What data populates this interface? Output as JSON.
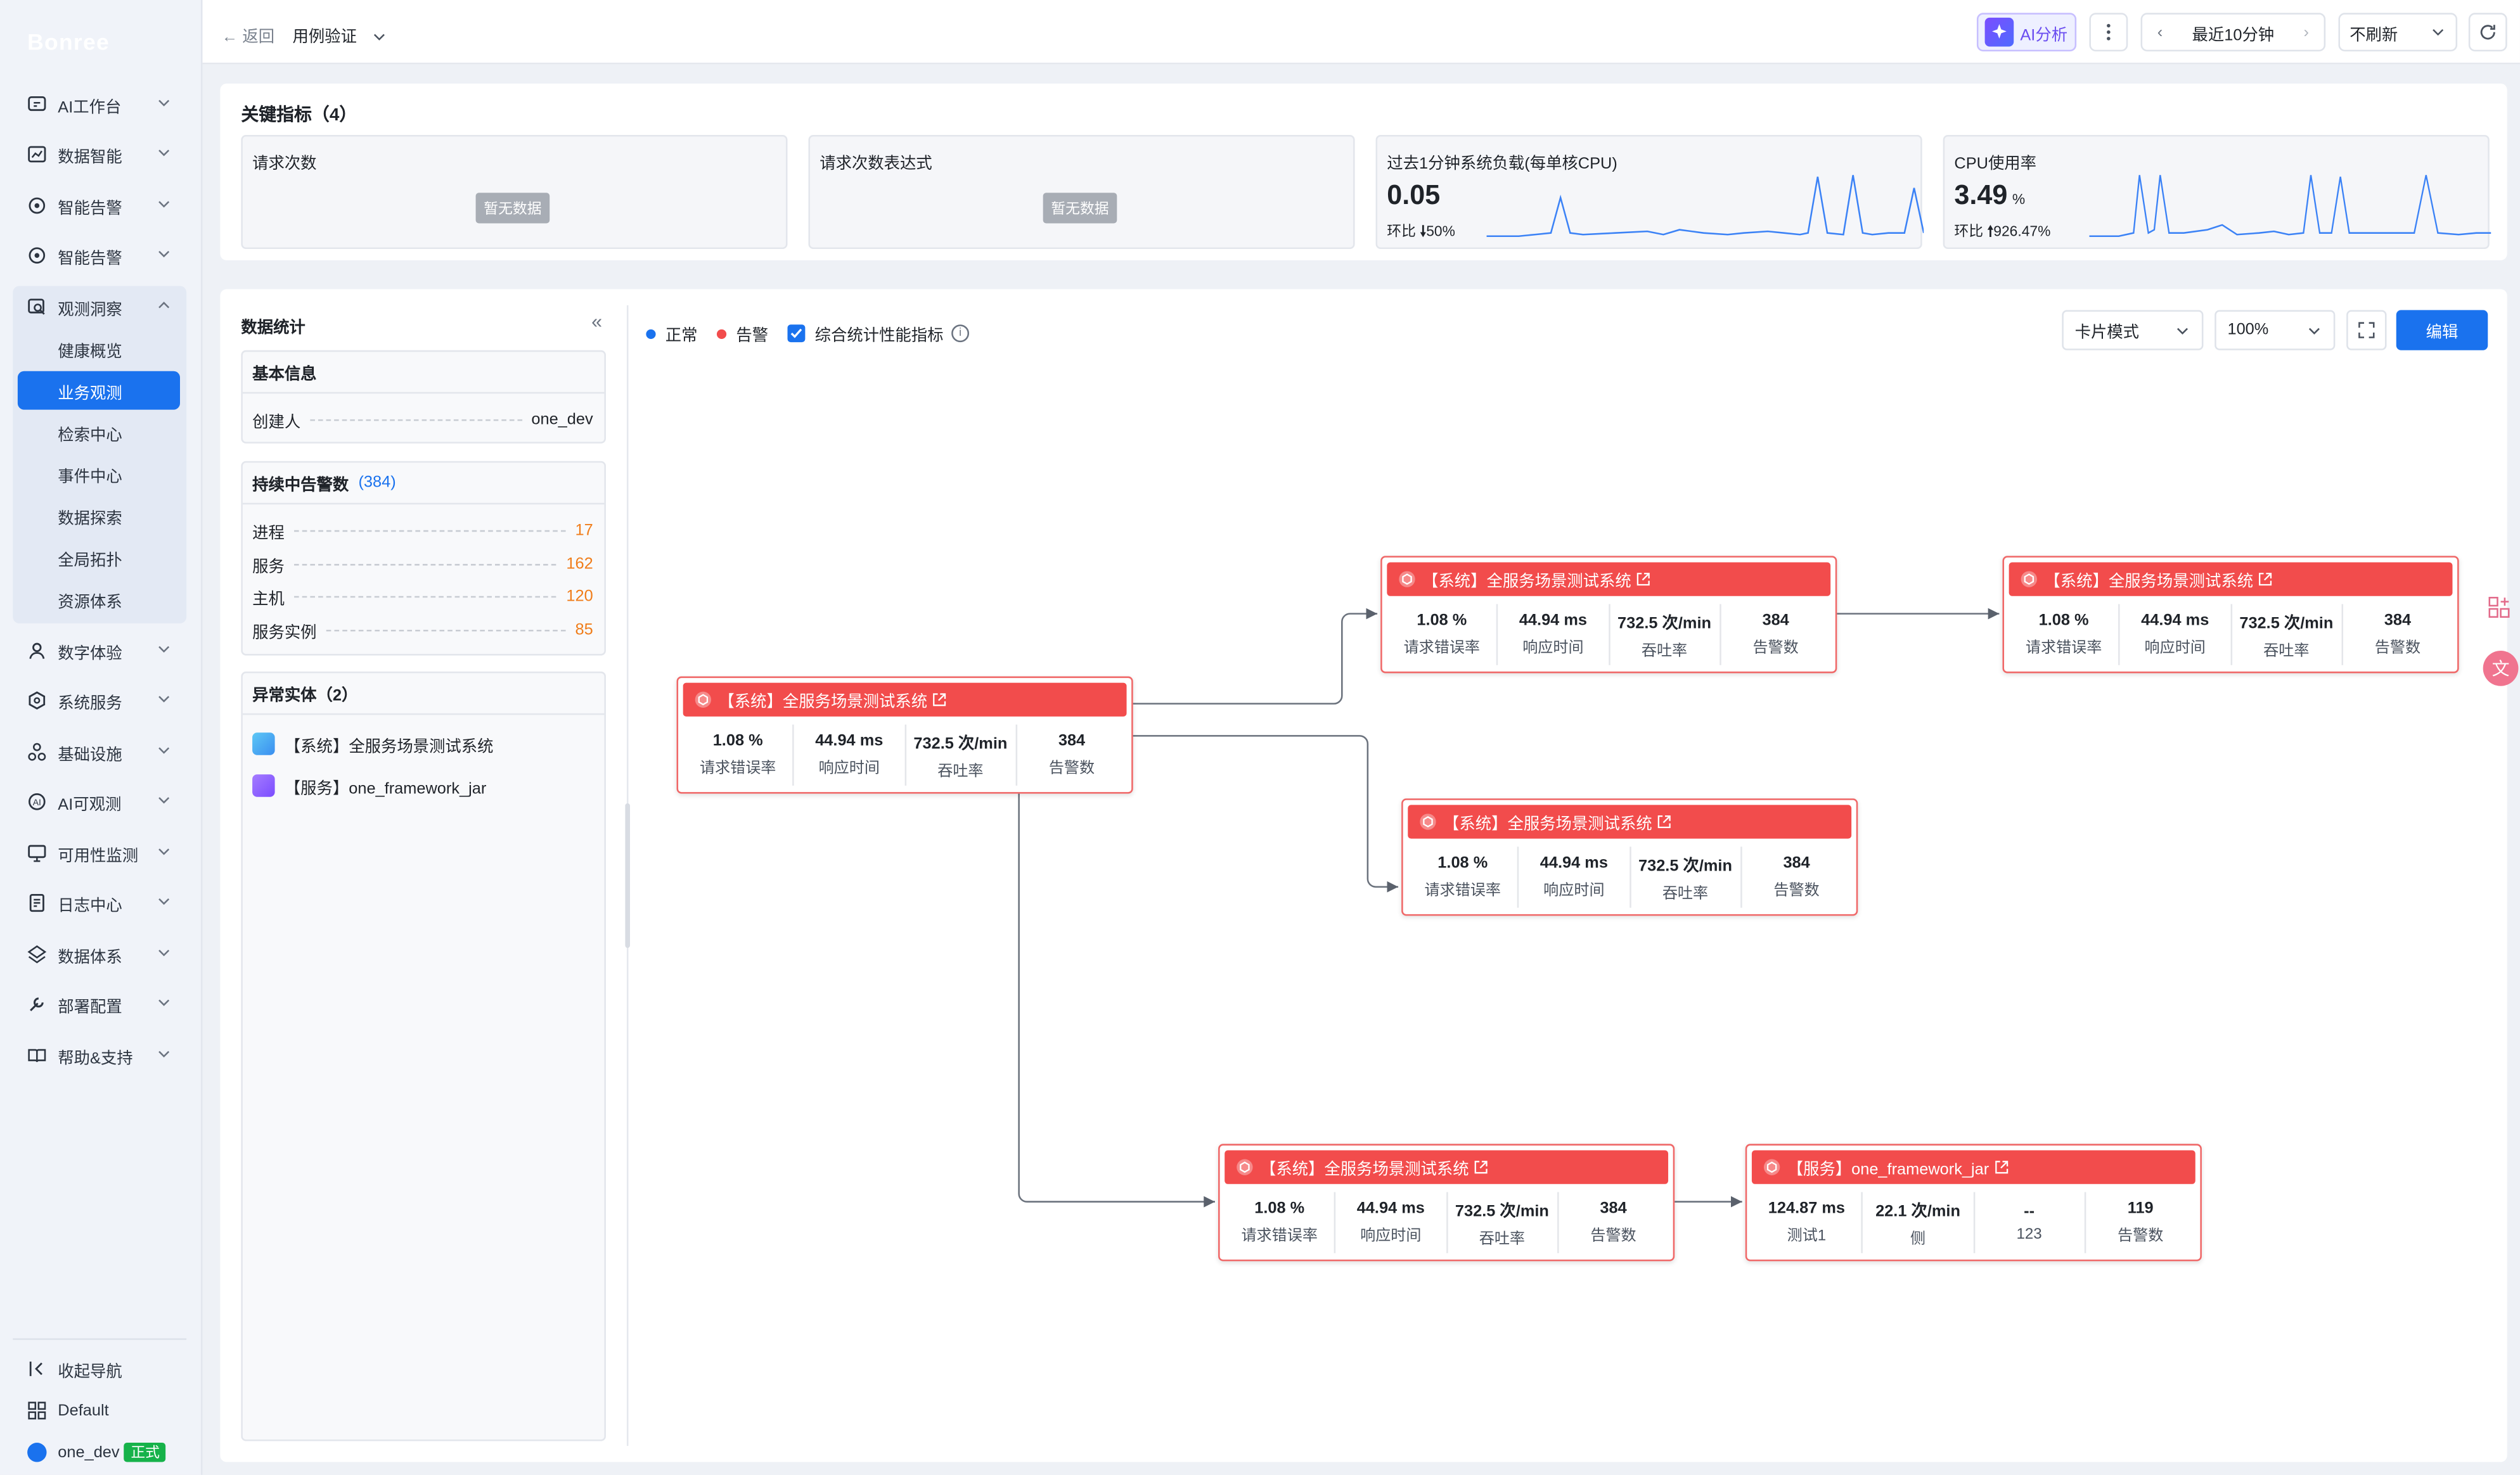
{
  "sidebar": {
    "logo": "Bonree",
    "items": [
      {
        "label": "AI工作台",
        "icon": "ai-workbench-icon"
      },
      {
        "label": "数据智能",
        "icon": "chart-icon"
      },
      {
        "label": "智能告警",
        "icon": "alert-icon"
      },
      {
        "label": "智能告警",
        "icon": "alert-icon"
      },
      {
        "label": "观测洞察",
        "icon": "observe-icon",
        "expanded": true
      },
      {
        "label": "数字体验",
        "icon": "user-icon"
      },
      {
        "label": "系统服务",
        "icon": "service-icon"
      },
      {
        "label": "基础设施",
        "icon": "infra-icon"
      },
      {
        "label": "AI可观测",
        "icon": "ai-icon"
      },
      {
        "label": "可用性监测",
        "icon": "monitor-icon"
      },
      {
        "label": "日志中心",
        "icon": "log-icon"
      },
      {
        "label": "数据体系",
        "icon": "data-icon"
      },
      {
        "label": "部署配置",
        "icon": "wrench-icon"
      },
      {
        "label": "帮助&支持",
        "icon": "book-icon"
      }
    ],
    "sub_items": [
      "健康概览",
      "业务观测",
      "检索中心",
      "事件中心",
      "数据探索",
      "全局拓扑",
      "资源体系"
    ],
    "active_sub": "业务观测",
    "collapse": "收起导航",
    "workspace": "Default",
    "user": "one_dev",
    "user_tag": "正式"
  },
  "topbar": {
    "back": "返回",
    "title": "用例验证",
    "ai": "AI分析",
    "range": "最近10分钟",
    "refresh": "不刷新"
  },
  "kpis": {
    "title": "关键指标（4）",
    "nodata": "暂无数据",
    "items": [
      {
        "title": "请求次数"
      },
      {
        "title": "请求次数表达式"
      },
      {
        "title": "过去1分钟系统负载(每单核CPU)",
        "value": "0.05",
        "unit": "",
        "cmp_label": "环比",
        "cmp": "50%",
        "trend": "down"
      },
      {
        "title": "CPU使用率",
        "value": "3.49",
        "unit": "%",
        "cmp_label": "环比",
        "cmp": "926.47%",
        "trend": "up"
      }
    ]
  },
  "stats": {
    "title": "数据统计",
    "basic": {
      "title": "基本信息",
      "creator_label": "创建人",
      "creator": "one_dev"
    },
    "alerts": {
      "title": "持续中告警数",
      "count": "(384)",
      "rows": [
        {
          "label": "进程",
          "value": "17"
        },
        {
          "label": "服务",
          "value": "162"
        },
        {
          "label": "主机",
          "value": "120"
        },
        {
          "label": "服务实例",
          "value": "85"
        }
      ]
    },
    "abnormal": {
      "title": "异常实体（2）",
      "items": [
        {
          "label": "【系统】全服务场景测试系统",
          "icon": "system-icon"
        },
        {
          "label": "【服务】one_framework_jar",
          "icon": "service-hex-icon"
        }
      ]
    }
  },
  "toolbar": {
    "legend_normal": "正常",
    "legend_alert": "告警",
    "checkbox": "综合统计性能指标",
    "mode": "卡片模式",
    "zoom": "100%",
    "edit": "编辑"
  },
  "colors": {
    "primary": "#1a72ee",
    "alert": "#f24c4c",
    "normal": "#1a72ee",
    "warn_text": "#f07d1a"
  },
  "nodes": [
    {
      "title": "【系统】全服务场景测试系统",
      "metrics": [
        {
          "v": "1.08 %",
          "l": "请求错误率"
        },
        {
          "v": "44.94 ms",
          "l": "响应时间"
        },
        {
          "v": "732.5 次/min",
          "l": "吞吐率"
        },
        {
          "v": "384",
          "l": "告警数"
        }
      ]
    },
    {
      "title": "【系统】全服务场景测试系统",
      "metrics": [
        {
          "v": "1.08 %",
          "l": "请求错误率"
        },
        {
          "v": "44.94 ms",
          "l": "响应时间"
        },
        {
          "v": "732.5 次/min",
          "l": "吞吐率"
        },
        {
          "v": "384",
          "l": "告警数"
        }
      ]
    },
    {
      "title": "【系统】全服务场景测试系统",
      "metrics": [
        {
          "v": "1.08 %",
          "l": "请求错误率"
        },
        {
          "v": "44.94 ms",
          "l": "响应时间"
        },
        {
          "v": "732.5 次/min",
          "l": "吞吐率"
        },
        {
          "v": "384",
          "l": "告警数"
        }
      ]
    },
    {
      "title": "【系统】全服务场景测试系统",
      "metrics": [
        {
          "v": "1.08 %",
          "l": "请求错误率"
        },
        {
          "v": "44.94 ms",
          "l": "响应时间"
        },
        {
          "v": "732.5 次/min",
          "l": "吞吐率"
        },
        {
          "v": "384",
          "l": "告警数"
        }
      ]
    },
    {
      "title": "【系统】全服务场景测试系统",
      "metrics": [
        {
          "v": "1.08 %",
          "l": "请求错误率"
        },
        {
          "v": "44.94 ms",
          "l": "响应时间"
        },
        {
          "v": "732.5 次/min",
          "l": "吞吐率"
        },
        {
          "v": "384",
          "l": "告警数"
        }
      ]
    },
    {
      "title": "【服务】one_framework_jar",
      "metrics": [
        {
          "v": "124.87 ms",
          "l": "测试1"
        },
        {
          "v": "22.1 次/min",
          "l": "侧"
        },
        {
          "v": "--",
          "l": "123"
        },
        {
          "v": "119",
          "l": "告警数"
        }
      ]
    }
  ]
}
